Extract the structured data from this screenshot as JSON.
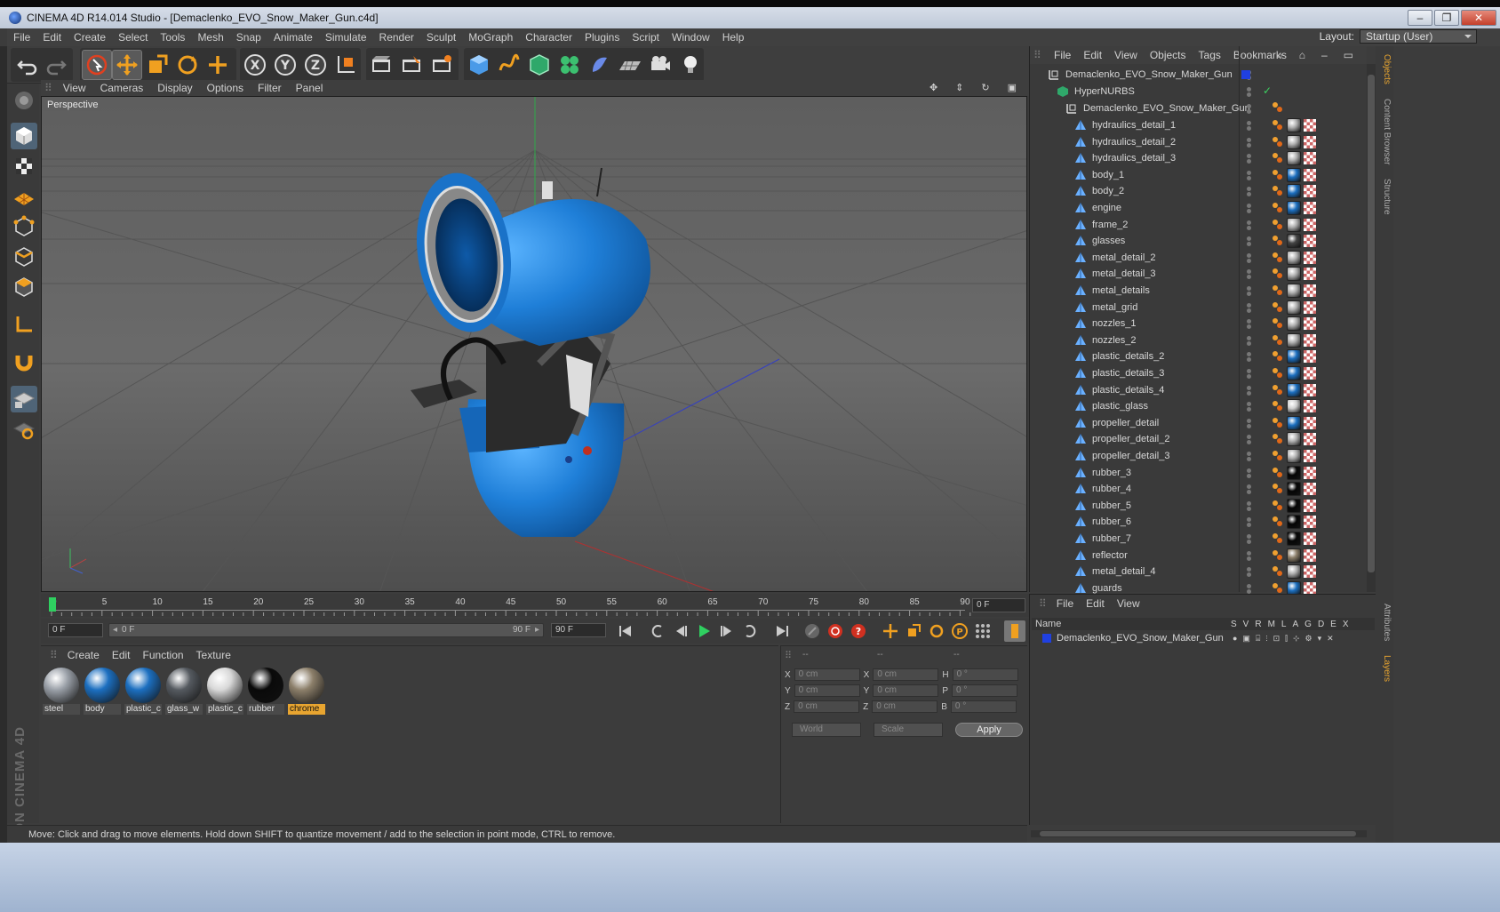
{
  "window": {
    "title": "CINEMA 4D R14.014 Studio - [Demaclenko_EVO_Snow_Maker_Gun.c4d]",
    "minimize": "–",
    "maximize": "❐",
    "close": "✕"
  },
  "menubar": [
    "File",
    "Edit",
    "Create",
    "Select",
    "Tools",
    "Mesh",
    "Snap",
    "Animate",
    "Simulate",
    "Render",
    "Sculpt",
    "MoGraph",
    "Character",
    "Plugins",
    "Script",
    "Window",
    "Help"
  ],
  "layout": {
    "label": "Layout:",
    "value": "Startup (User)"
  },
  "viewport": {
    "menu": [
      "View",
      "Cameras",
      "Display",
      "Options",
      "Filter",
      "Panel"
    ],
    "label": "Perspective"
  },
  "timeline": {
    "ticks": [
      "0",
      "5",
      "10",
      "15",
      "20",
      "25",
      "30",
      "35",
      "40",
      "45",
      "50",
      "55",
      "60",
      "65",
      "70",
      "75",
      "80",
      "85",
      "90"
    ],
    "current_frame": "0 F",
    "start_field": "0 F",
    "range_start": "0 F",
    "range_end": "90 F",
    "end_field": "90 F"
  },
  "materials": {
    "menu": [
      "Create",
      "Edit",
      "Function",
      "Texture"
    ],
    "items": [
      {
        "label": "steel",
        "color": "#9aa0a8",
        "selected": false
      },
      {
        "label": "body",
        "color": "#1c6fc0",
        "selected": false
      },
      {
        "label": "plastic_c",
        "color": "#1c6fc0",
        "selected": false
      },
      {
        "label": "glass_w",
        "color": "#555a60",
        "selected": false
      },
      {
        "label": "plastic_c",
        "color": "#d8d8d8",
        "selected": false
      },
      {
        "label": "rubber",
        "color": "#0a0a0a",
        "selected": false
      },
      {
        "label": "chrome",
        "color": "#8c7f6a",
        "selected": true
      }
    ]
  },
  "coordinates": {
    "headers": [
      "--",
      "--",
      "--"
    ],
    "rows": [
      {
        "a": "X",
        "av": "0 cm",
        "b": "X",
        "bv": "0 cm",
        "c": "H",
        "cv": "0 °"
      },
      {
        "a": "Y",
        "av": "0 cm",
        "b": "Y",
        "bv": "0 cm",
        "c": "P",
        "cv": "0 °"
      },
      {
        "a": "Z",
        "av": "0 cm",
        "b": "Z",
        "bv": "0 cm",
        "c": "B",
        "cv": "0 °"
      }
    ],
    "mode1": "World",
    "mode2": "Scale",
    "apply": "Apply"
  },
  "status": "Move: Click and drag to move elements. Hold down SHIFT to quantize movement / add to the selection in point mode, CTRL to remove.",
  "objects": {
    "menu": [
      "File",
      "Edit",
      "View",
      "Objects",
      "Tags",
      "Bookmarks"
    ],
    "root": "Demaclenko_EVO_Snow_Maker_Gun",
    "nurbs": "HyperNURBS",
    "group": "Demaclenko_EVO_Snow_Maker_Gun",
    "items": [
      {
        "name": "hydraulics_detail_1",
        "mat": "#b0b0b0"
      },
      {
        "name": "hydraulics_detail_2",
        "mat": "#b0b0b0"
      },
      {
        "name": "hydraulics_detail_3",
        "mat": "#b0b0b0"
      },
      {
        "name": "body_1",
        "mat": "#1c6fc0"
      },
      {
        "name": "body_2",
        "mat": "#1c6fc0"
      },
      {
        "name": "engine",
        "mat": "#1c6fc0"
      },
      {
        "name": "frame_2",
        "mat": "#b0b0b0"
      },
      {
        "name": "glasses",
        "mat": "#444"
      },
      {
        "name": "metal_detail_2",
        "mat": "#b0b0b0"
      },
      {
        "name": "metal_detail_3",
        "mat": "#b0b0b0"
      },
      {
        "name": "metal_details",
        "mat": "#b0b0b0"
      },
      {
        "name": "metal_grid",
        "mat": "#b0b0b0"
      },
      {
        "name": "nozzles_1",
        "mat": "#b0b0b0"
      },
      {
        "name": "nozzles_2",
        "mat": "#b0b0b0"
      },
      {
        "name": "plastic_details_2",
        "mat": "#1c6fc0"
      },
      {
        "name": "plastic_details_3",
        "mat": "#1c6fc0"
      },
      {
        "name": "plastic_details_4",
        "mat": "#1c6fc0"
      },
      {
        "name": "plastic_glass",
        "mat": "#cfcfcf"
      },
      {
        "name": "propeller_detail",
        "mat": "#1c6fc0"
      },
      {
        "name": "propeller_detail_2",
        "mat": "#b0b0b0"
      },
      {
        "name": "propeller_detail_3",
        "mat": "#b0b0b0"
      },
      {
        "name": "rubber_3",
        "mat": "#050505"
      },
      {
        "name": "rubber_4",
        "mat": "#050505"
      },
      {
        "name": "rubber_5",
        "mat": "#050505"
      },
      {
        "name": "rubber_6",
        "mat": "#050505"
      },
      {
        "name": "rubber_7",
        "mat": "#050505"
      },
      {
        "name": "reflector",
        "mat": "#8c7f6a"
      },
      {
        "name": "metal_detail_4",
        "mat": "#b0b0b0"
      },
      {
        "name": "guards",
        "mat": "#1c6fc0"
      }
    ]
  },
  "layers": {
    "menu": [
      "File",
      "Edit",
      "View"
    ],
    "name_header": "Name",
    "cols": [
      "S",
      "V",
      "R",
      "M",
      "L",
      "A",
      "G",
      "D",
      "E",
      "X"
    ],
    "row": "Demaclenko_EVO_Snow_Maker_Gun"
  },
  "right_tabs": [
    "Objects",
    "Content Browser",
    "Structure",
    "Attributes",
    "Layers"
  ],
  "colors": {
    "accent": "#e8a530",
    "selection": "#4f6477",
    "body_blue": "#1c6fc0"
  }
}
